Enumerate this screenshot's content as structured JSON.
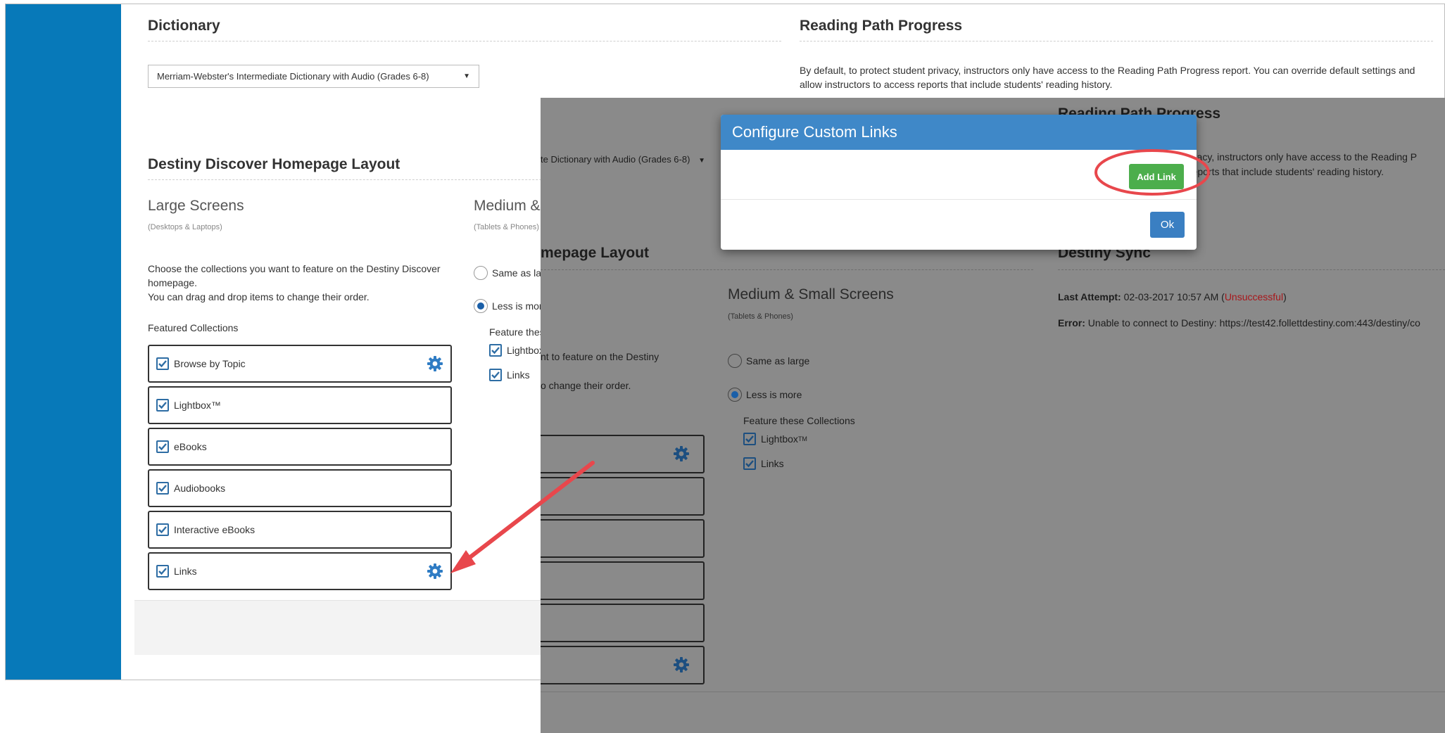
{
  "dictionary": {
    "title": "Dictionary",
    "selected": "Merriam-Webster's Intermediate Dictionary with Audio (Grades 6-8)"
  },
  "reading_path": {
    "title": "Reading Path Progress",
    "description": "By default, to protect student privacy, instructors only have access to the Reading Path Progress report. You can override default settings and allow instructors to access reports that include students' reading history."
  },
  "layout": {
    "title": "Destiny Discover Homepage Layout",
    "large": {
      "title": "Large Screens",
      "subtitle": "(Desktops & Laptops)",
      "instructions_1": "Choose the collections you want to feature on the Destiny Discover homepage.",
      "instructions_2": "You can drag and drop items to change their order.",
      "featured_label": "Featured Collections",
      "collections": [
        "Browse by Topic",
        "Lightbox™",
        "eBooks",
        "Audiobooks",
        "Interactive eBooks",
        "Links"
      ]
    },
    "medium": {
      "title": "Medium & Small Screens",
      "subtitle": "(Tablets & Phones)",
      "option_same": "Same as large",
      "option_less": "Less is more",
      "feature_label": "Feature these Collections",
      "collections": [
        "Lightbox™",
        "Links"
      ]
    }
  },
  "overlay": {
    "select_fragment": "te Dictionary with Audio (Grades 6-8)",
    "layout_title_fragment": "mepage Layout",
    "instr_fragment_1": "nt to feature on the Destiny",
    "instr_fragment_2": "o change their order.",
    "reading_title_fragment": "Reading Path Progress",
    "reading_text_1": "privacy, instructors only have access to the Reading P",
    "reading_text_2": "s reports that include students' reading history.",
    "sync": {
      "title": "Destiny Sync",
      "last_attempt_label": "Last Attempt:",
      "last_attempt_value": "02-03-2017 10:57 AM",
      "status": "Unsuccessful",
      "error_label": "Error:",
      "error_value": "Unable to connect to Destiny: https://test42.follettdestiny.com:443/destiny/co"
    },
    "medium_title": "Medium & Small Screens",
    "medium_subtitle": "(Tablets & Phones)",
    "option_same": "Same as large",
    "option_less": "Less is more",
    "feature_label": "Feature these Collections",
    "lightbox_label": "Lightbox",
    "lightbox_tm": "TM",
    "links_label": "Links"
  },
  "modal": {
    "title": "Configure Custom Links",
    "add_link": "Add Link",
    "ok": "Ok"
  },
  "colors": {
    "sidebar": "#0779b9",
    "modal_header": "#3f88c8",
    "add_button": "#4cae4c",
    "ok_button": "#3a7fc2",
    "annotation": "#e8474c",
    "unsuccessful": "#d9231d"
  }
}
